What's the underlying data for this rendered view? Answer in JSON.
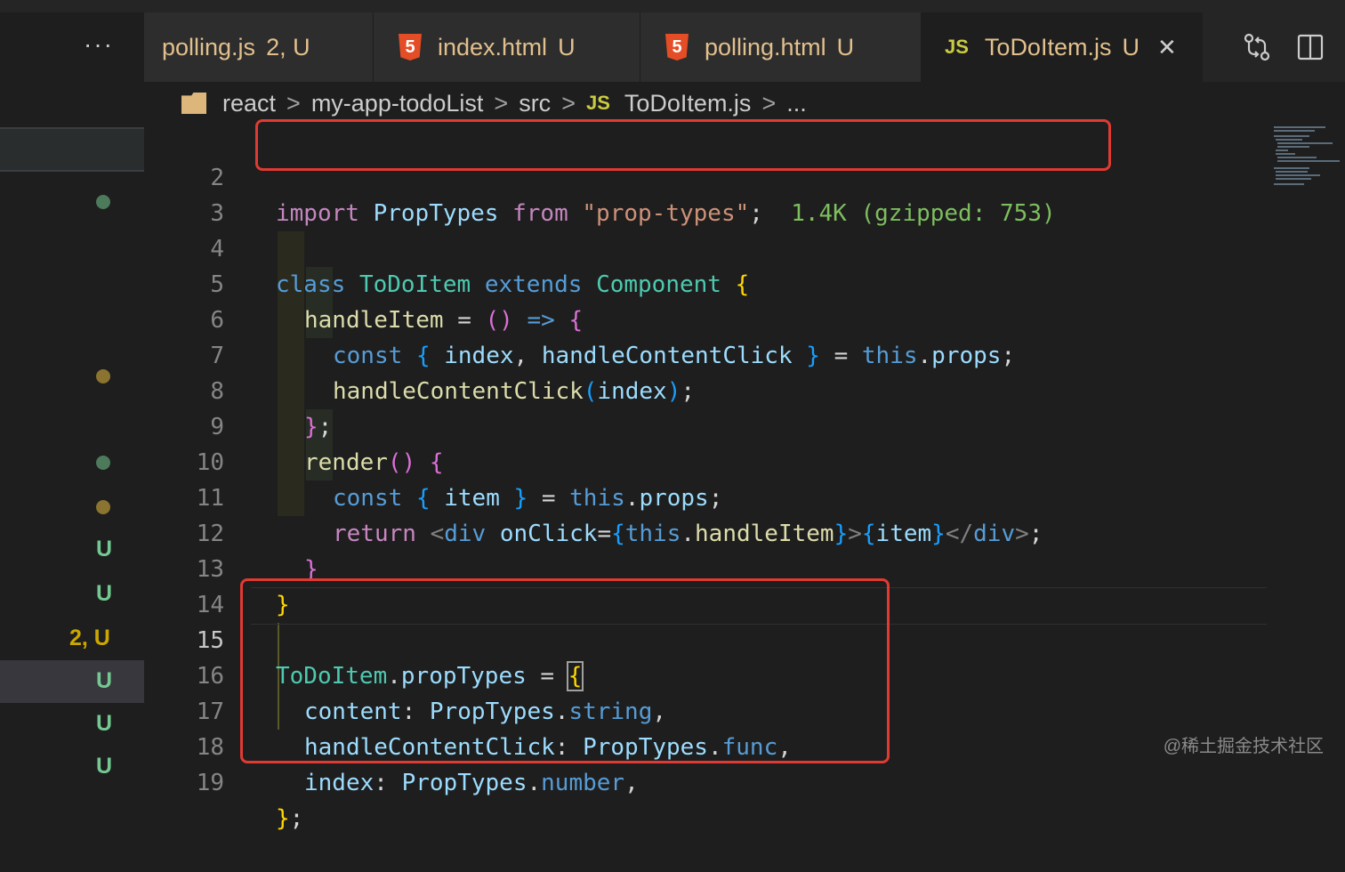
{
  "tabs": {
    "overflow": "···",
    "items": [
      {
        "icon": "js",
        "name": "polling.js",
        "status": "2, U"
      },
      {
        "icon": "html5",
        "icon_glyph": "5",
        "name": "index.html",
        "status": "U"
      },
      {
        "icon": "html5",
        "icon_glyph": "5",
        "name": "polling.html",
        "status": "U"
      },
      {
        "icon": "js",
        "icon_glyph": "JS",
        "name": "ToDoItem.js",
        "status": "U",
        "active": true
      }
    ],
    "close": "✕"
  },
  "breadcrumb": {
    "items": [
      "react",
      "my-app-todoList",
      "src",
      "ToDoItem.js",
      "..."
    ],
    "js_glyph": "JS",
    "separator": ">"
  },
  "explorer_badges": [
    "U",
    "U",
    "2, U",
    "U",
    "U",
    "U"
  ],
  "line_numbers": [
    "2",
    "3",
    "4",
    "5",
    "6",
    "7",
    "8",
    "9",
    "10",
    "11",
    "12",
    "13",
    "14",
    "15",
    "16",
    "17",
    "18",
    "19"
  ],
  "import_size": "1.4K (gzipped: 753)",
  "code": {
    "l2": {
      "import": "import",
      "ident": "PropTypes",
      "from": "from",
      "string": "\"prop-types\"",
      "semi": ";"
    },
    "l4": {
      "class": "class",
      "name": "ToDoItem",
      "extends": "extends",
      "base": "Component",
      "brace": "{"
    },
    "l5": {
      "fn": "handleItem",
      "eq": " = ",
      "paren": "()",
      "arrow": " => ",
      "brace": "{"
    },
    "l6": {
      "const": "const",
      "ob": "{",
      "a": "index",
      "comma": ", ",
      "b": "handleContentClick",
      "cb": "}",
      "eq": " = ",
      "this": "this",
      "dot": ".",
      "props": "props",
      "semi": ";"
    },
    "l7": {
      "fn": "handleContentClick",
      "op": "(",
      "arg": "index",
      "cp": ")",
      "semi": ";"
    },
    "l8": {
      "brace": "}",
      "semi": ";"
    },
    "l9": {
      "fn": "render",
      "paren": "()",
      "brace": "{"
    },
    "l10": {
      "const": "const",
      "ob": "{",
      "a": "item",
      "cb": "}",
      "eq": " = ",
      "this": "this",
      "dot": ".",
      "props": "props",
      "semi": ";"
    },
    "l11": {
      "return": "return",
      "lt": "<",
      "tag": "div",
      "attr": "onClick",
      "eq": "=",
      "ob": "{",
      "this": "this",
      "dot": ".",
      "handler": "handleItem",
      "cb": "}",
      "gt": ">",
      "ob2": "{",
      "item": "item",
      "cb2": "}",
      "close_lt": "</",
      "close_tag": "div",
      "close_gt": ">",
      "semi": ";"
    },
    "l12": {
      "brace": "}"
    },
    "l13": {
      "brace": "}"
    },
    "l15": {
      "name": "ToDoItem",
      "dot": ".",
      "prop": "propTypes",
      "eq": " = ",
      "brace": "{"
    },
    "l16": {
      "key": "content",
      "colon": ": ",
      "obj": "PropTypes",
      "dot": ".",
      "type": "string",
      "comma": ","
    },
    "l17": {
      "key": "handleContentClick",
      "colon": ": ",
      "obj": "PropTypes",
      "dot": ".",
      "type": "func",
      "comma": ","
    },
    "l18": {
      "key": "index",
      "colon": ": ",
      "obj": "PropTypes",
      "dot": ".",
      "type": "number",
      "comma": ","
    },
    "l19": {
      "brace": "}",
      "semi": ";"
    }
  },
  "watermark": "@稀土掘金技术社区"
}
